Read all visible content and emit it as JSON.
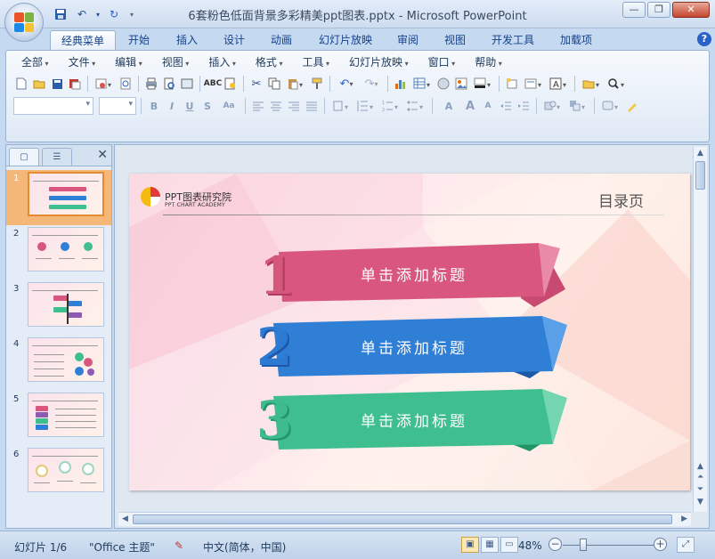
{
  "window": {
    "title": "6套粉色低面背景多彩精美ppt图表.pptx - Microsoft PowerPoint",
    "minimize": "—",
    "restore": "❐",
    "close": "✕"
  },
  "ribbon_tabs": [
    "经典菜单",
    "开始",
    "插入",
    "设计",
    "动画",
    "幻灯片放映",
    "审阅",
    "视图",
    "开发工具",
    "加载项"
  ],
  "help": "?",
  "menu": [
    "全部",
    "文件",
    "编辑",
    "视图",
    "插入",
    "格式",
    "工具",
    "幻灯片放映",
    "窗口",
    "帮助"
  ],
  "format_bar": {
    "bold": "B",
    "italic": "I",
    "underline": "U",
    "shadow": "S",
    "char_spacing": "Aa",
    "font_grow": "A",
    "font_shrink": "A",
    "text_box": "A"
  },
  "slides": [
    {
      "number": "1"
    },
    {
      "number": "2"
    },
    {
      "number": "3"
    },
    {
      "number": "4"
    },
    {
      "number": "5"
    },
    {
      "number": "6"
    }
  ],
  "slide": {
    "logo_cn": "PPT图表研究院",
    "logo_en": "PPT CHART ACADEMY",
    "heading": "目录页",
    "items": [
      {
        "number": "1",
        "label": "单击添加标题",
        "color": "#d9577e",
        "dark": "#b03a60",
        "numcolor": "#d6577c"
      },
      {
        "number": "2",
        "label": "单击添加标题",
        "color": "#2f7fd6",
        "dark": "#1c5aa8",
        "numcolor": "#2c7ad2"
      },
      {
        "number": "3",
        "label": "单击添加标题",
        "color": "#3fbf8f",
        "dark": "#239468",
        "numcolor": "#3dbb8c"
      }
    ]
  },
  "status": {
    "slide_counter": "幻灯片 1/6",
    "theme": "\"Office 主题\"",
    "language": "中文(简体，中国)",
    "zoom": "48%",
    "zoom_minus": "−",
    "zoom_plus": "+"
  },
  "colors": {
    "accent_blue": "#15428b",
    "selected_thumb": "#f5b777"
  }
}
